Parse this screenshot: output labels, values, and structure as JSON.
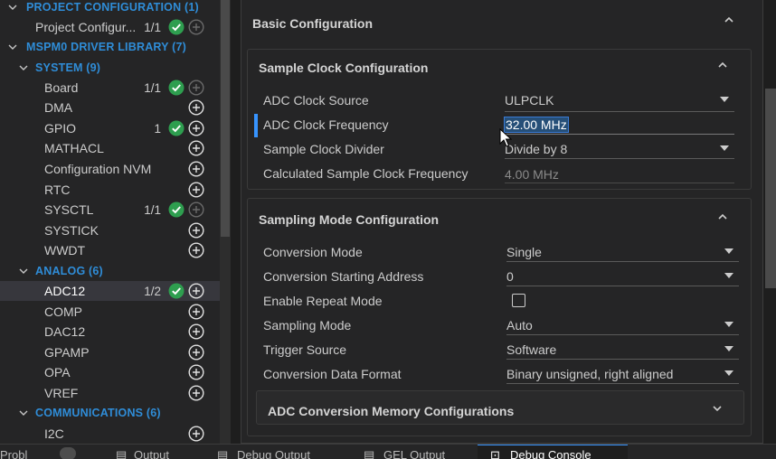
{
  "tree": {
    "project_configuration": {
      "label": "PROJECT CONFIGURATION (1)"
    },
    "project_config_item": {
      "label": "Project Configur...",
      "count": "1/1"
    },
    "driver_library": {
      "label": "MSPM0 DRIVER LIBRARY (7)"
    },
    "system": {
      "label": "SYSTEM (9)",
      "items": [
        {
          "label": "Board",
          "count": "1/1",
          "ok": true
        },
        {
          "label": "DMA",
          "count": "",
          "ok": false
        },
        {
          "label": "GPIO",
          "count": "1",
          "ok": true
        },
        {
          "label": "MATHACL",
          "count": "",
          "ok": false
        },
        {
          "label": "Configuration NVM",
          "count": "",
          "ok": false
        },
        {
          "label": "RTC",
          "count": "",
          "ok": false
        },
        {
          "label": "SYSCTL",
          "count": "1/1",
          "ok": true
        },
        {
          "label": "SYSTICK",
          "count": "",
          "ok": false
        },
        {
          "label": "WWDT",
          "count": "",
          "ok": false
        }
      ]
    },
    "analog": {
      "label": "ANALOG (6)",
      "items": [
        {
          "label": "ADC12",
          "count": "1/2",
          "ok": true
        },
        {
          "label": "COMP",
          "count": "",
          "ok": false
        },
        {
          "label": "DAC12",
          "count": "",
          "ok": false
        },
        {
          "label": "GPAMP",
          "count": "",
          "ok": false
        },
        {
          "label": "OPA",
          "count": "",
          "ok": false
        },
        {
          "label": "VREF",
          "count": "",
          "ok": false
        }
      ]
    },
    "communications": {
      "label": "COMMUNICATIONS (6)",
      "items": [
        {
          "label": "I2C",
          "count": "",
          "ok": false
        }
      ]
    }
  },
  "main": {
    "basic_title": "Basic Configuration",
    "sample_clock": {
      "title": "Sample Clock Configuration",
      "fields": {
        "adc_clock_source": {
          "label": "ADC Clock Source",
          "value": "ULPCLK"
        },
        "adc_clock_frequency": {
          "label": "ADC Clock Frequency",
          "value": "32.00 MHz"
        },
        "sample_clock_divider": {
          "label": "Sample Clock Divider",
          "value": "Divide by 8"
        },
        "calculated_frequency": {
          "label": "Calculated Sample Clock Frequency",
          "value": "4.00 MHz"
        }
      }
    },
    "sampling_mode": {
      "title": "Sampling Mode Configuration",
      "fields": {
        "conversion_mode": {
          "label": "Conversion Mode",
          "value": "Single"
        },
        "conversion_start": {
          "label": "Conversion Starting Address",
          "value": "0"
        },
        "repeat_mode": {
          "label": "Enable Repeat Mode",
          "checked": false
        },
        "sampling_mode": {
          "label": "Sampling Mode",
          "value": "Auto"
        },
        "trigger_source": {
          "label": "Trigger Source",
          "value": "Software"
        },
        "data_format": {
          "label": "Conversion Data Format",
          "value": "Binary unsigned, right aligned"
        }
      }
    },
    "memory_configs": {
      "title": "ADC Conversion Memory Configurations"
    }
  },
  "bottom_tabs": [
    {
      "label": "Probl",
      "icon": "problems-icon"
    },
    {
      "label": "Output",
      "icon": "output-icon"
    },
    {
      "label": "Debug Output",
      "icon": "debug-output-icon"
    },
    {
      "label": "GEL Output",
      "icon": "gel-output-icon"
    },
    {
      "label": "Debug Console",
      "icon": "console-icon",
      "active": true
    }
  ],
  "colors": {
    "accent": "#3794ff",
    "category": "#2f8dd8",
    "check_ok": "#2e9e4f",
    "selection": "#264f78"
  }
}
